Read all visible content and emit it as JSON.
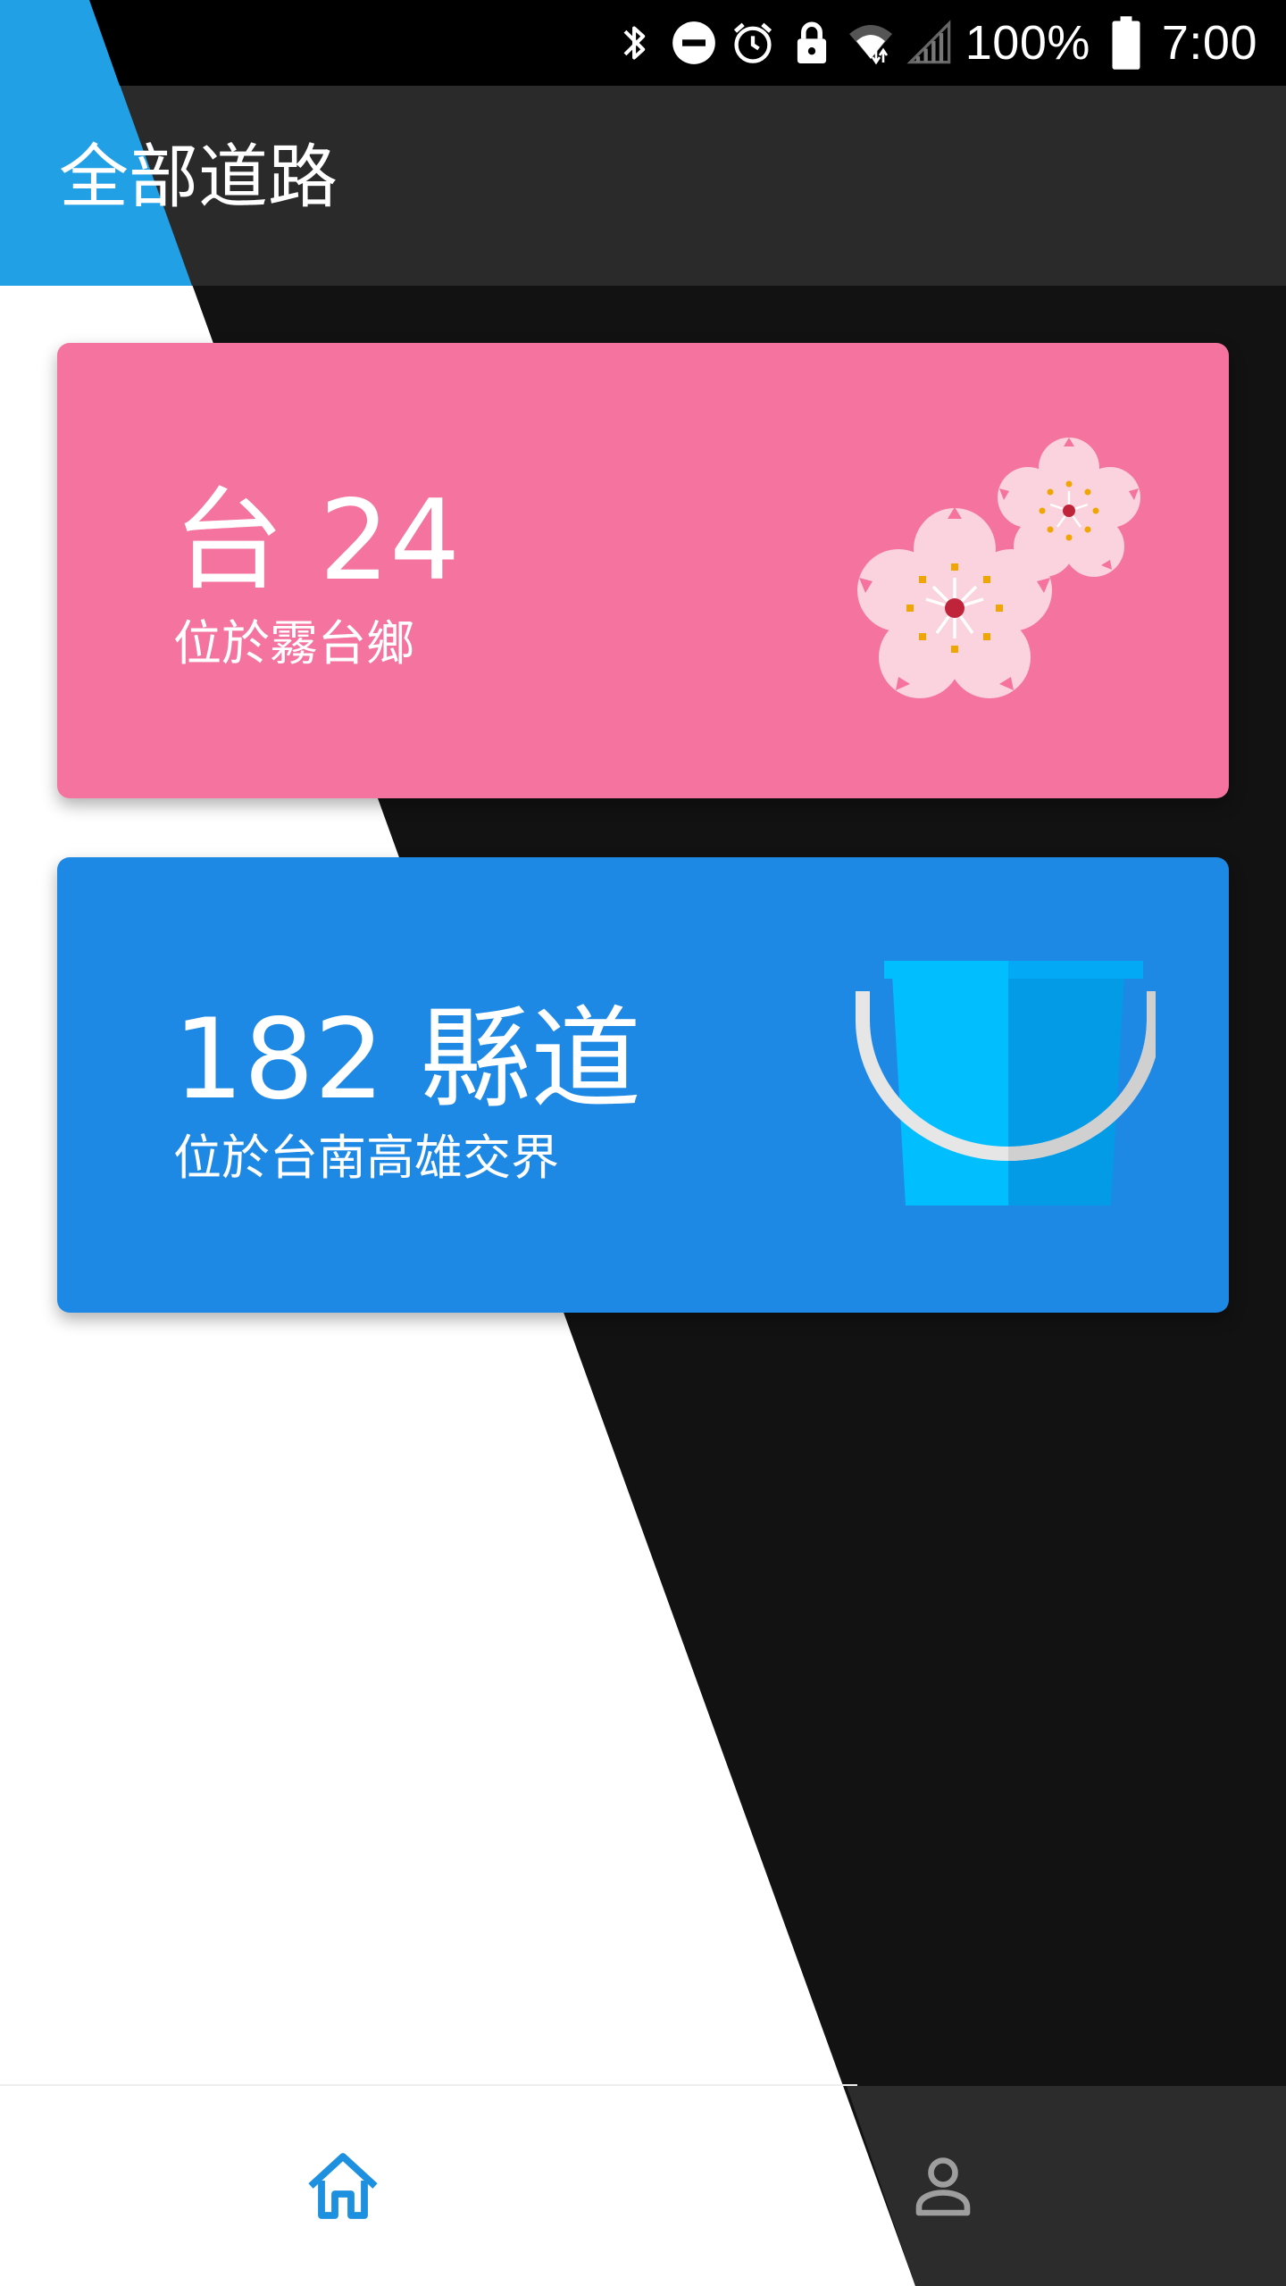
{
  "app": {
    "title": "全部道路"
  },
  "status_bar": {
    "battery_percent": "100%",
    "time": "7:00",
    "icons": [
      "bluetooth-icon",
      "do-not-disturb-icon",
      "alarm-icon",
      "lock-icon",
      "wifi-icon",
      "cell-signal-icon",
      "battery-icon"
    ]
  },
  "roads": [
    {
      "title": "台 24",
      "subtitle": "位於霧台鄉",
      "color": "#F4739F",
      "icon": "cherry-blossom-icon"
    },
    {
      "title": "182 縣道",
      "subtitle": "位於台南高雄交界",
      "color": "#1E88E5",
      "icon": "bucket-icon"
    }
  ],
  "bottom_nav": {
    "items": [
      {
        "name": "home",
        "icon": "home-icon",
        "active": true,
        "color": "#1E90E0"
      },
      {
        "name": "profile",
        "icon": "person-icon",
        "active": false,
        "color": "#9E9E9E"
      }
    ]
  },
  "colors": {
    "accent_blue": "#22A0E6",
    "dark_bg": "#121212",
    "appbar_dark": "#2A2A2B",
    "white": "#FFFFFF"
  }
}
